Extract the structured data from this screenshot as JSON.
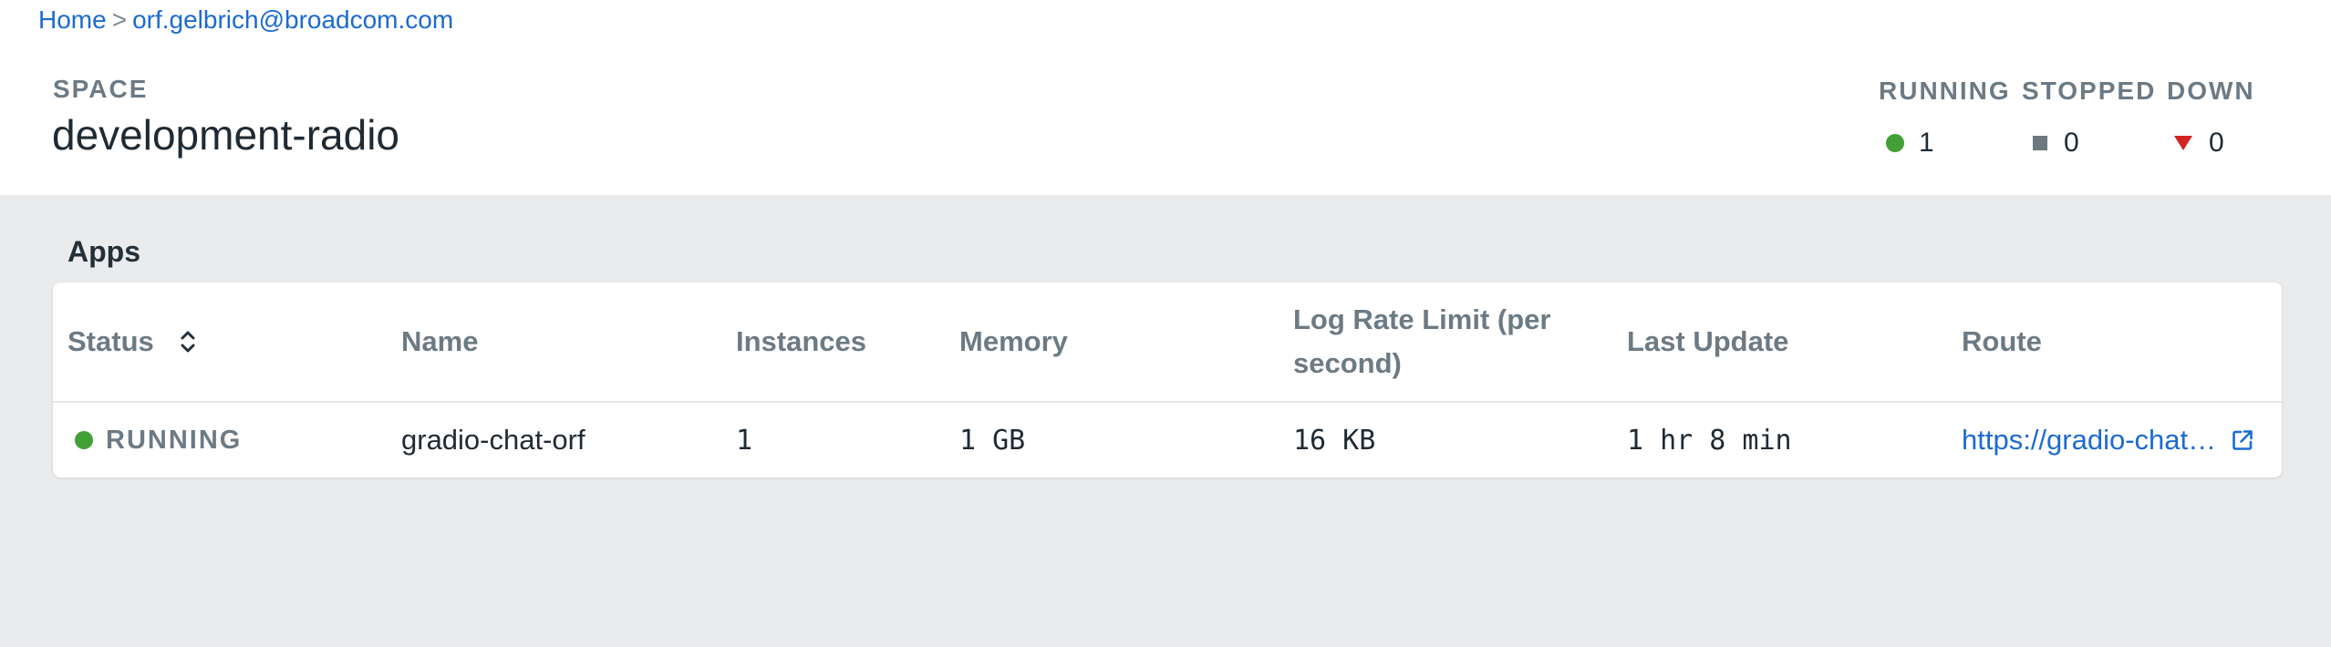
{
  "breadcrumb": {
    "home": "Home",
    "separator": ">",
    "org": "orf.gelbrich@broadcom.com"
  },
  "space": {
    "label": "SPACE",
    "name": "development-radio"
  },
  "stats": {
    "running": {
      "label": "RUNNING",
      "value": "1",
      "color": "#43a037"
    },
    "stopped": {
      "label": "STOPPED",
      "value": "0",
      "color": "#6d7880"
    },
    "down": {
      "label": "DOWN",
      "value": "0",
      "color": "#d42323"
    }
  },
  "apps": {
    "title": "Apps",
    "columns": [
      "Status",
      "Name",
      "Instances",
      "Memory",
      "Log Rate Limit (per second)",
      "Last Update",
      "Route"
    ],
    "rows": [
      {
        "status": "RUNNING",
        "name": "gradio-chat-orf",
        "instances": "1",
        "memory": "1 GB",
        "log_rate_limit": "16 KB",
        "last_update": "1 hr 8 min",
        "route": "https://gradio-chat…"
      }
    ]
  },
  "icons": {
    "sort": "sort-icon",
    "external_link": "external-link-icon"
  }
}
